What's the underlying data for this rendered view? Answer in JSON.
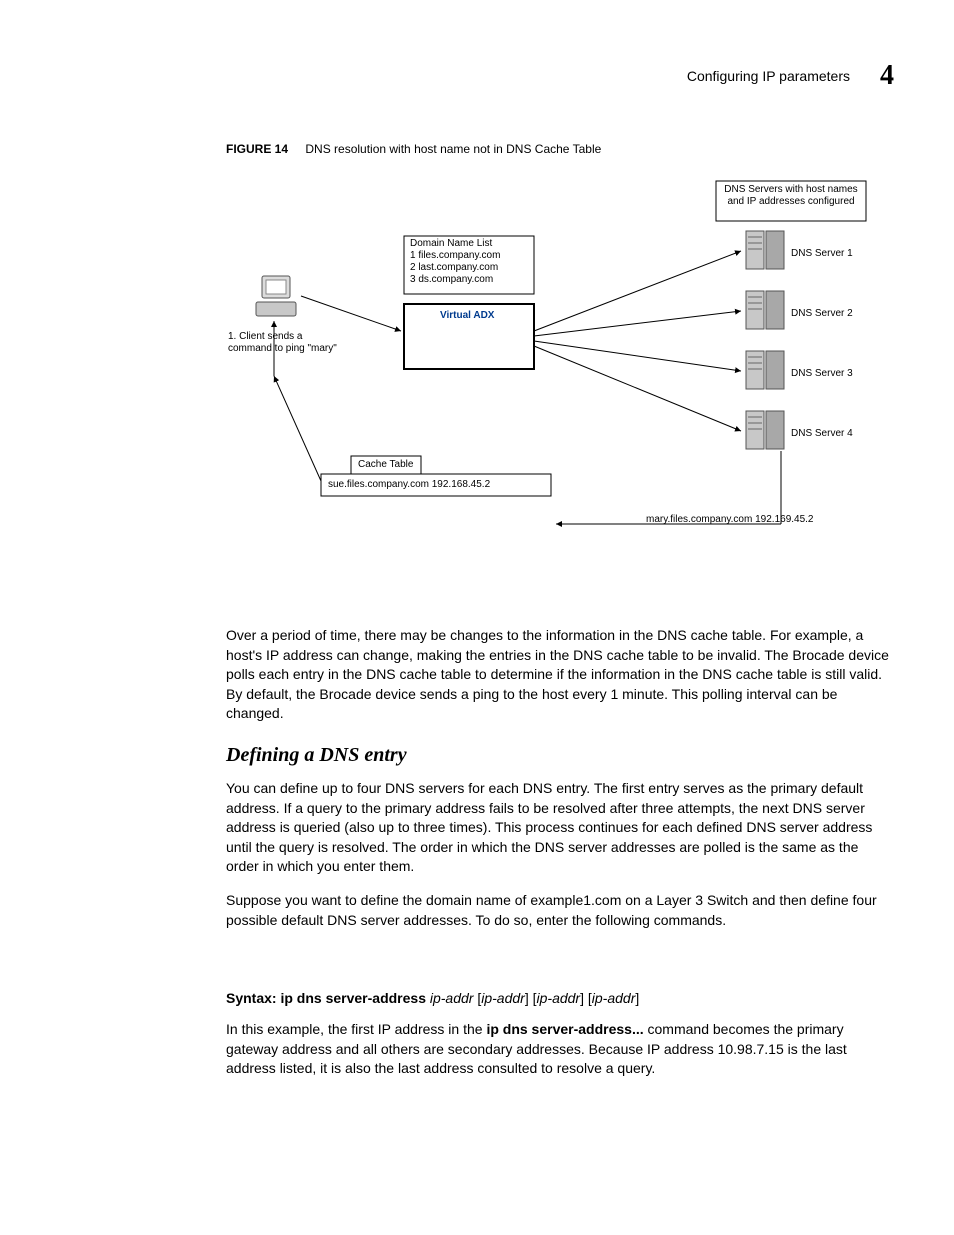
{
  "header": {
    "title": "Configuring IP parameters",
    "chapterNumber": "4"
  },
  "figure": {
    "label": "FIGURE 14",
    "caption": "DNS resolution with host name not in DNS Cache Table"
  },
  "diagram": {
    "dnsServersHeader": "DNS Servers with host names and IP addresses configured",
    "domainListTitle": "Domain Name List",
    "domainList1": "1 files.company.com",
    "domainList2": "2 last.company.com",
    "domainList3": "3 ds.company.com",
    "virtualAdx": "Virtual ADX",
    "clientNote": "1. Client sends a command to ping \"mary\"",
    "cacheTableTitle": "Cache Table",
    "cacheEntry": "sue.files.company.com  192.168.45.2",
    "responseEntry": "mary.files.company.com  192.169.45.2",
    "server1": "DNS Server 1",
    "server2": "DNS Server 2",
    "server3": "DNS Server 3",
    "server4": "DNS Server 4"
  },
  "para1": "Over a period of time, there may be changes to the information in the DNS cache table. For example, a host's IP address can change, making the entries in the DNS cache table to be invalid. The Brocade device polls each entry in the DNS cache table to determine if the information in the DNS cache table is still valid. By default, the Brocade device sends a ping to the host every 1 minute. This polling interval can be changed.",
  "sectionHeading": "Defining a DNS entry",
  "para2": "You can define up to four DNS servers for each DNS entry. The first entry serves as the primary default address. If a query to the primary address fails to be resolved after three attempts, the next DNS server address is queried (also up to three times). This process continues for each defined DNS server address until the query is resolved. The order in which the DNS server addresses are polled is the same as the order in which you enter them.",
  "para3": "Suppose you want to define the domain name of example1.com on a Layer 3 Switch and then define four possible default DNS server addresses. To do so, enter the following commands.",
  "syntax": {
    "label": "Syntax:",
    "cmd": "ip dns server-address",
    "arg1": "ip-addr",
    "arg2": "ip-addr",
    "arg3": "ip-addr",
    "arg4": "ip-addr"
  },
  "para4a": "In this example, the first IP address in the ",
  "para4bold": "ip dns server-address...",
  "para4b": " command becomes the primary gateway address and all others are secondary addresses. Because IP address 10.98.7.15 is the last address listed, it is also the last address consulted to resolve a query."
}
